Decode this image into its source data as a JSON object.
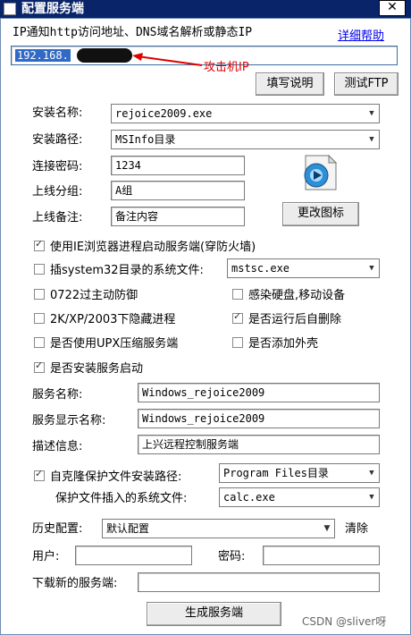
{
  "window": {
    "title": "配置服务端",
    "close": "✕"
  },
  "ip": {
    "prompt": "IP通知http访问地址、DNS域名解析或静态IP",
    "help_link": "详细帮助",
    "value": "192.168.",
    "annotation": "攻击机IP",
    "fill_button": "填写说明",
    "test_button": "测试FTP"
  },
  "install": {
    "name_label": "安装名称:",
    "name_value": "rejoice2009.exe",
    "path_label": "安装路径:",
    "path_value": "MSInfo目录",
    "password_label": "连接密码:",
    "password_value": "1234",
    "group_label": "上线分组:",
    "group_value": "A组",
    "note_label": "上线备注:",
    "note_value": "备注内容",
    "change_icon_button": "更改图标"
  },
  "options": {
    "ie_process": {
      "label": "使用IE浏览器进程启动服务端(穿防火墙)",
      "checked": true
    },
    "system32": {
      "label": "插system32目录的系统文件:",
      "checked": false,
      "value": "mstsc.exe"
    },
    "active_defense": {
      "label": "0722过主动防御",
      "checked": false
    },
    "infect_disk": {
      "label": "感染硬盘,移动设备",
      "checked": false
    },
    "hide_process": {
      "label": "2K/XP/2003下隐藏进程",
      "checked": false
    },
    "self_delete": {
      "label": "是否运行后自删除",
      "checked": true
    },
    "upx": {
      "label": "是否使用UPX压缩服务端",
      "checked": false
    },
    "add_shell": {
      "label": "是否添加外壳",
      "checked": false
    },
    "install_service": {
      "label": "是否安装服务启动",
      "checked": true
    }
  },
  "service": {
    "name_label": "服务名称:",
    "name_value": "Windows_rejoice2009",
    "display_label": "服务显示名称:",
    "display_value": "Windows_rejoice2009",
    "desc_label": "描述信息:",
    "desc_value": "上兴远程控制服务端"
  },
  "protect": {
    "clone_label": "自克隆保护文件安装路径:",
    "clone_checked": true,
    "clone_value": "Program Files目录",
    "insert_label": "保护文件插入的系统文件:",
    "insert_value": "calc.exe"
  },
  "history": {
    "label": "历史配置:",
    "value": "默认配置",
    "clear": "清除"
  },
  "account": {
    "user_label": "用户:",
    "user_value": "",
    "pass_label": "密码:",
    "pass_value": ""
  },
  "download": {
    "label": "下载新的服务端:",
    "value": ""
  },
  "generate_button": "生成服务端",
  "watermark": "CSDN @sliver呀"
}
